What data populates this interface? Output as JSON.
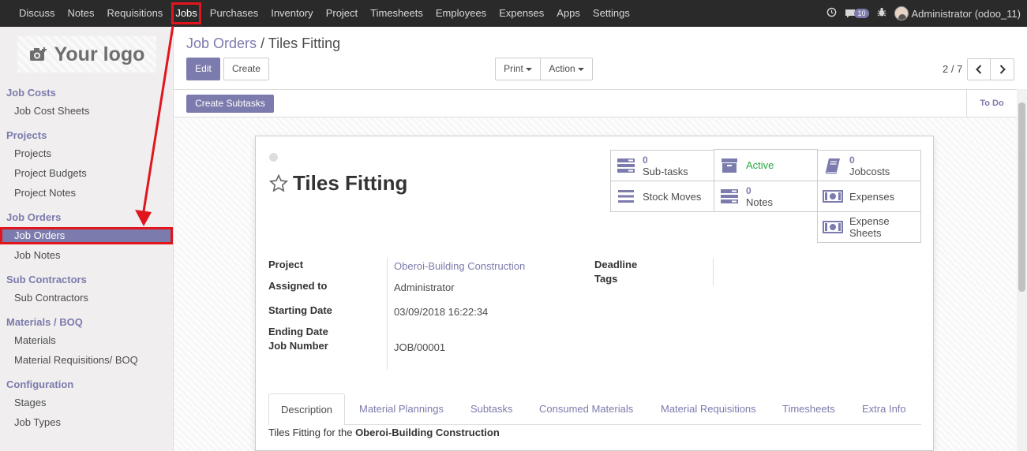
{
  "topbar": {
    "menu": [
      "Discuss",
      "Notes",
      "Requisitions",
      "Jobs",
      "Purchases",
      "Inventory",
      "Project",
      "Timesheets",
      "Employees",
      "Expenses",
      "Apps",
      "Settings"
    ],
    "message_count": "10",
    "user": "Administrator (odoo_11)"
  },
  "sidebar": {
    "logo_text": "Your logo",
    "sections": [
      {
        "title": "Job Costs",
        "items": [
          "Job Cost Sheets"
        ]
      },
      {
        "title": "Projects",
        "items": [
          "Projects",
          "Project Budgets",
          "Project Notes"
        ]
      },
      {
        "title": "Job Orders",
        "items": [
          "Job Orders",
          "Job Notes"
        ]
      },
      {
        "title": "Sub Contractors",
        "items": [
          "Sub Contractors"
        ]
      },
      {
        "title": "Materials / BOQ",
        "items": [
          "Materials",
          "Material Requisitions/ BOQ"
        ]
      },
      {
        "title": "Configuration",
        "items": [
          "Stages",
          "Job Types"
        ]
      }
    ]
  },
  "breadcrumb": {
    "parent": "Job Orders",
    "separator": "/",
    "current": "Tiles Fitting"
  },
  "buttons": {
    "edit": "Edit",
    "create": "Create",
    "print": "Print",
    "action": "Action",
    "create_subtasks": "Create Subtasks"
  },
  "pager": {
    "value": "2 / 7"
  },
  "stage": "To Do",
  "record": {
    "title": "Tiles Fitting",
    "smart_buttons": {
      "subtasks": {
        "count": "0",
        "label": "Sub-tasks"
      },
      "active": {
        "label": "Active"
      },
      "jobcosts": {
        "count": "0",
        "label": "Jobcosts"
      },
      "stock_moves": {
        "label": "Stock Moves"
      },
      "notes": {
        "count": "0",
        "label": "Notes"
      },
      "expenses": {
        "label": "Expenses"
      },
      "expense_sheets": {
        "label": "Expense Sheets"
      }
    },
    "fields": {
      "project": {
        "label": "Project",
        "value": "Oberoi-Building Construction"
      },
      "assigned_to": {
        "label": "Assigned to",
        "value": "Administrator"
      },
      "starting_date": {
        "label": "Starting Date",
        "value": "03/09/2018 16:22:34"
      },
      "ending_date": {
        "label": "Ending Date",
        "value": ""
      },
      "job_number": {
        "label": "Job Number",
        "value": "JOB/00001"
      },
      "deadline": {
        "label": "Deadline",
        "value": ""
      },
      "tags": {
        "label": "Tags",
        "value": ""
      }
    },
    "tabs": [
      "Description",
      "Material Plannings",
      "Subtasks",
      "Consumed Materials",
      "Material Requisitions",
      "Timesheets",
      "Extra Info"
    ],
    "description": {
      "prefix": "Tiles Fitting for the ",
      "bold": "Oberoi-Building Construction"
    }
  },
  "colors": {
    "brand": "#7c7bad",
    "topbar": "#2a2a2a",
    "highlight": "#e0161c",
    "active_green": "#28a745"
  }
}
